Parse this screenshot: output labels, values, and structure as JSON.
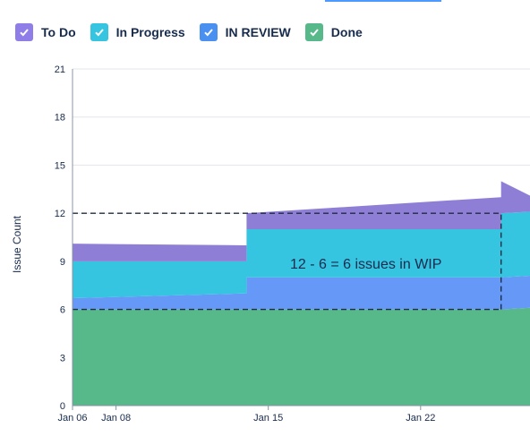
{
  "legend": [
    {
      "label": "To Do",
      "color": "#8f7ee7",
      "checked": true
    },
    {
      "label": "In Progress",
      "color": "#36c5e0",
      "checked": true
    },
    {
      "label": "IN REVIEW",
      "color": "#4a90f0",
      "checked": true
    },
    {
      "label": "Done",
      "color": "#57b88a",
      "checked": true
    }
  ],
  "chart_data": {
    "type": "area",
    "stacked": true,
    "ylabel": "Issue Count",
    "ylim": [
      0,
      21
    ],
    "yticks": [
      0,
      3,
      6,
      9,
      12,
      15,
      18,
      21
    ],
    "xlim": [
      "2020-01-06",
      "2020-01-28"
    ],
    "xticks": [
      {
        "date": "2020-01-06",
        "label": "Jan 06"
      },
      {
        "date": "2020-01-08",
        "label": "Jan 08"
      },
      {
        "date": "2020-01-15",
        "label": "Jan 15"
      },
      {
        "date": "2020-01-22",
        "label": "Jan 22"
      }
    ],
    "grid": true,
    "series": [
      {
        "name": "Done",
        "color": "#57b88a",
        "points": [
          {
            "x": "2020-01-06",
            "y": 6
          },
          {
            "x": "2020-01-14",
            "y": 6
          },
          {
            "x": "2020-01-25.7",
            "y": 6
          },
          {
            "x": "2020-01-28",
            "y": 6.1
          }
        ]
      },
      {
        "name": "IN REVIEW",
        "color": "#6699f7",
        "points": [
          {
            "x": "2020-01-06",
            "y": 0.7
          },
          {
            "x": "2020-01-14",
            "y": 1
          },
          {
            "x": "2020-01-14",
            "y": 2
          },
          {
            "x": "2020-01-28",
            "y": 2
          }
        ]
      },
      {
        "name": "In Progress",
        "color": "#36c5e0",
        "points": [
          {
            "x": "2020-01-06",
            "y": 2.3
          },
          {
            "x": "2020-01-14",
            "y": 2
          },
          {
            "x": "2020-01-14",
            "y": 3
          },
          {
            "x": "2020-01-25.7",
            "y": 3
          },
          {
            "x": "2020-01-25.7",
            "y": 4
          },
          {
            "x": "2020-01-28",
            "y": 4
          }
        ]
      },
      {
        "name": "To Do",
        "color": "#8f7ed6",
        "points": [
          {
            "x": "2020-01-06",
            "y": 1.1
          },
          {
            "x": "2020-01-14",
            "y": 1
          },
          {
            "x": "2020-01-25.7",
            "y": 2
          },
          {
            "x": "2020-01-28",
            "y": 1
          }
        ]
      }
    ],
    "reference_lines": [
      {
        "y": 12,
        "x_from": "2020-01-06",
        "x_to": "2020-01-25.7",
        "style": "dashed"
      },
      {
        "y": 6,
        "x_from": "2020-01-06",
        "x_to": "2020-01-25.7",
        "style": "dashed"
      },
      {
        "x": "2020-01-25.7",
        "y_from": 6,
        "y_to": 12,
        "style": "dashed"
      }
    ],
    "annotation": "12 - 6 = 6 issues in WIP"
  }
}
